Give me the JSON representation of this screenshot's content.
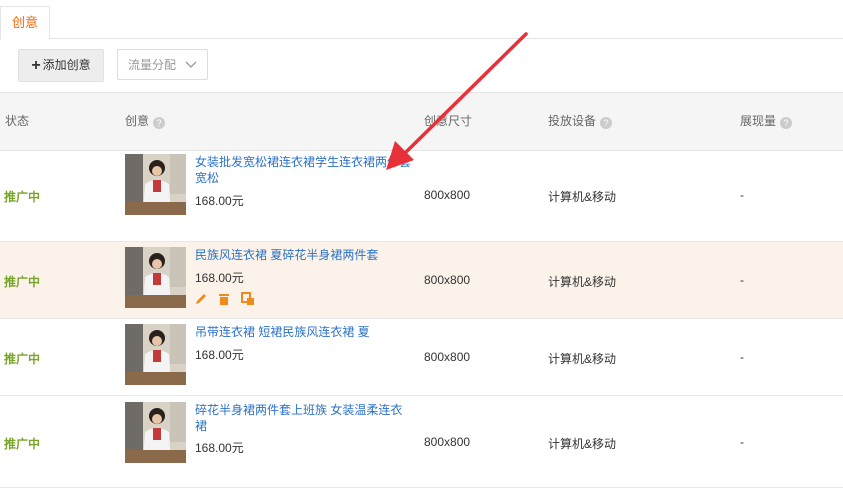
{
  "tabs": [
    {
      "label": "创意"
    }
  ],
  "toolbar": {
    "add_label": "添加创意",
    "traffic_select": "流量分配"
  },
  "table": {
    "headers": {
      "status": "状态",
      "creative": "创意",
      "size": "创意尺寸",
      "device": "投放设备",
      "impressions": "展现量"
    },
    "rows": [
      {
        "status": "推广中",
        "title": "女装批发宽松裙连衣裙学生连衣裙两件套宽松",
        "price": "168.00元",
        "size": "800x800",
        "device": "计算机&移动",
        "impressions": "-"
      },
      {
        "status": "推广中",
        "title": "民族风连衣裙 夏碎花半身裙两件套",
        "price": "168.00元",
        "size": "800x800",
        "device": "计算机&移动",
        "impressions": "-"
      },
      {
        "status": "推广中",
        "title": "吊带连衣裙 短裙民族风连衣裙 夏",
        "price": "168.00元",
        "size": "800x800",
        "device": "计算机&移动",
        "impressions": "-"
      },
      {
        "status": "推广中",
        "title": "碎花半身裙两件套上班族 女装温柔连衣裙",
        "price": "168.00元",
        "size": "800x800",
        "device": "计算机&移动",
        "impressions": "-"
      }
    ]
  },
  "colors": {
    "accent": "#ff6600",
    "link": "#2b72c8",
    "status": "#7aa52b",
    "highlight_row": "#fbf3ea",
    "arrow": "#e8303a"
  }
}
